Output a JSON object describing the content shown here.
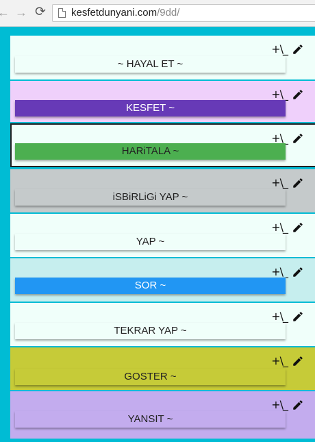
{
  "browser": {
    "url_domain": "kesfetdunyani.com",
    "url_path": "/9dd/"
  },
  "colors": {
    "background": "#00bcd4"
  },
  "tools": {
    "branch_label": "+\\_",
    "edit_icon": "pencil-icon"
  },
  "cards": [
    {
      "label": "~ HAYAL ET ~",
      "card_bg": "#f0fffa",
      "bar_bg": "#f0fffa",
      "text_color": "#222222"
    },
    {
      "label": "KESFET ~",
      "card_bg": "#efd0fb",
      "bar_bg": "#673ab7",
      "text_color": "#ffffff"
    },
    {
      "label": "HARiTALA ~",
      "card_bg": "#f0fffa",
      "bar_bg": "#4caf50",
      "text_color": "#222222",
      "selected": true
    },
    {
      "label": "iSBiRLiGi YAP ~",
      "card_bg": "#c5cacb",
      "bar_bg": "#c5cacb",
      "text_color": "#222222"
    },
    {
      "label": "YAP ~",
      "card_bg": "#f0fffa",
      "bar_bg": "#f0fffa",
      "text_color": "#222222"
    },
    {
      "label": "SOR ~",
      "card_bg": "#c6eeee",
      "bar_bg": "#2196f3",
      "text_color": "#ffffff"
    },
    {
      "label": "TEKRAR YAP ~",
      "card_bg": "#f0fffa",
      "bar_bg": "#f0fffa",
      "text_color": "#222222"
    },
    {
      "label": "GOSTER ~",
      "card_bg": "#c6cb38",
      "bar_bg": "#c6cb38",
      "text_color": "#222222"
    },
    {
      "label": "YANSIT ~",
      "card_bg": "#c3acee",
      "bar_bg": "#c3acee",
      "text_color": "#222222"
    }
  ]
}
